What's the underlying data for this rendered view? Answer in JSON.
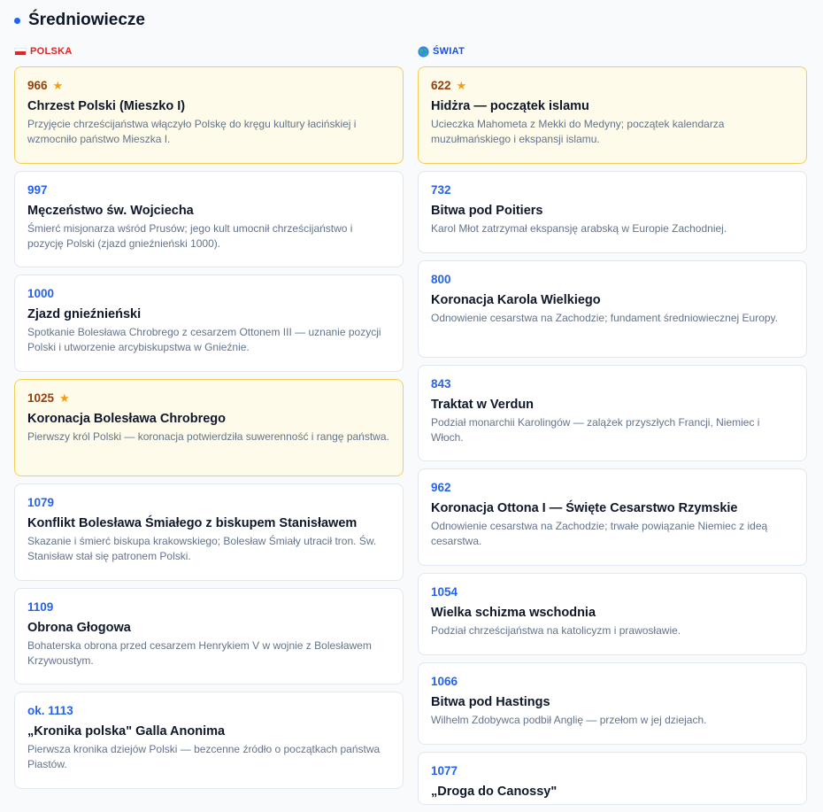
{
  "section": {
    "title": "Średniowiecze"
  },
  "columns": {
    "polska": {
      "label": "POLSKA",
      "icon": "poland-flag-icon"
    },
    "swiat": {
      "label": "ŚWIAT",
      "icon": "globe-icon"
    }
  },
  "colors": {
    "accent": "#2563eb",
    "polska_label": "#dc2626",
    "swiat_label": "#1d4ed8",
    "highlight_border": "#f4cf55",
    "highlight_bg": "#fefbea",
    "star": "#f59e0b"
  },
  "polska_events": [
    {
      "year": "966",
      "highlighted": true,
      "title": "Chrzest Polski (Mieszko I)",
      "desc": "Przyjęcie chrześcijaństwa włączyło Polskę do kręgu kultury łacińskiej i wzmocniło państwo Mieszka I."
    },
    {
      "year": "997",
      "highlighted": false,
      "title": "Męczeństwo św. Wojciecha",
      "desc": "Śmierć misjonarza wśród Prusów; jego kult umocnił chrześcijaństwo i pozycję Polski (zjazd gnieźnieński 1000)."
    },
    {
      "year": "1000",
      "highlighted": false,
      "title": "Zjazd gnieźnieński",
      "desc": "Spotkanie Bolesława Chrobrego z cesarzem Ottonem III — uznanie pozycji Polski i utworzenie arcybiskupstwa w Gnieźnie."
    },
    {
      "year": "1025",
      "highlighted": true,
      "title": "Koronacja Bolesława Chrobrego",
      "desc": "Pierwszy król Polski — koronacja potwierdziła suwerenność i rangę państwa."
    },
    {
      "year": "1079",
      "highlighted": false,
      "title": "Konflikt Bolesława Śmiałego z biskupem Stanisławem",
      "desc": "Skazanie i śmierć biskupa krakowskiego; Bolesław Śmiały utracił tron. Św. Stanisław stał się patronem Polski."
    },
    {
      "year": "1109",
      "highlighted": false,
      "title": "Obrona Głogowa",
      "desc": "Bohaterska obrona przed cesarzem Henrykiem V w wojnie z Bolesławem Krzywoustym."
    },
    {
      "year": "ok. 1113",
      "highlighted": false,
      "title": "„Kronika polska\" Galla Anonima",
      "desc": "Pierwsza kronika dziejów Polski — bezcenne źródło o początkach państwa Piastów."
    }
  ],
  "swiat_events": [
    {
      "year": "622",
      "highlighted": true,
      "title": "Hidżra — początek islamu",
      "desc": "Ucieczka Mahometa z Mekki do Medyny; początek kalendarza muzułmańskiego i ekspansji islamu."
    },
    {
      "year": "732",
      "highlighted": false,
      "title": "Bitwa pod Poitiers",
      "desc": "Karol Młot zatrzymał ekspansję arabską w Europie Zachodniej."
    },
    {
      "year": "800",
      "highlighted": false,
      "title": "Koronacja Karola Wielkiego",
      "desc": "Odnowienie cesarstwa na Zachodzie; fundament średniowiecznej Europy."
    },
    {
      "year": "843",
      "highlighted": false,
      "title": "Traktat w Verdun",
      "desc": "Podział monarchii Karolingów — zalążek przyszłych Francji, Niemiec i Włoch."
    },
    {
      "year": "962",
      "highlighted": false,
      "title": "Koronacja Ottona I — Święte Cesarstwo Rzymskie",
      "desc": "Odnowienie cesarstwa na Zachodzie; trwałe powiązanie Niemiec z ideą cesarstwa."
    },
    {
      "year": "1054",
      "highlighted": false,
      "title": "Wielka schizma wschodnia",
      "desc": "Podział chrześcijaństwa na katolicyzm i prawosławie."
    },
    {
      "year": "1066",
      "highlighted": false,
      "title": "Bitwa pod Hastings",
      "desc": "Wilhelm Zdobywca podbił Anglię — przełom w jej dziejach."
    },
    {
      "year": "1077",
      "highlighted": false,
      "title": "„Droga do Canossy\"",
      "desc": ""
    }
  ]
}
